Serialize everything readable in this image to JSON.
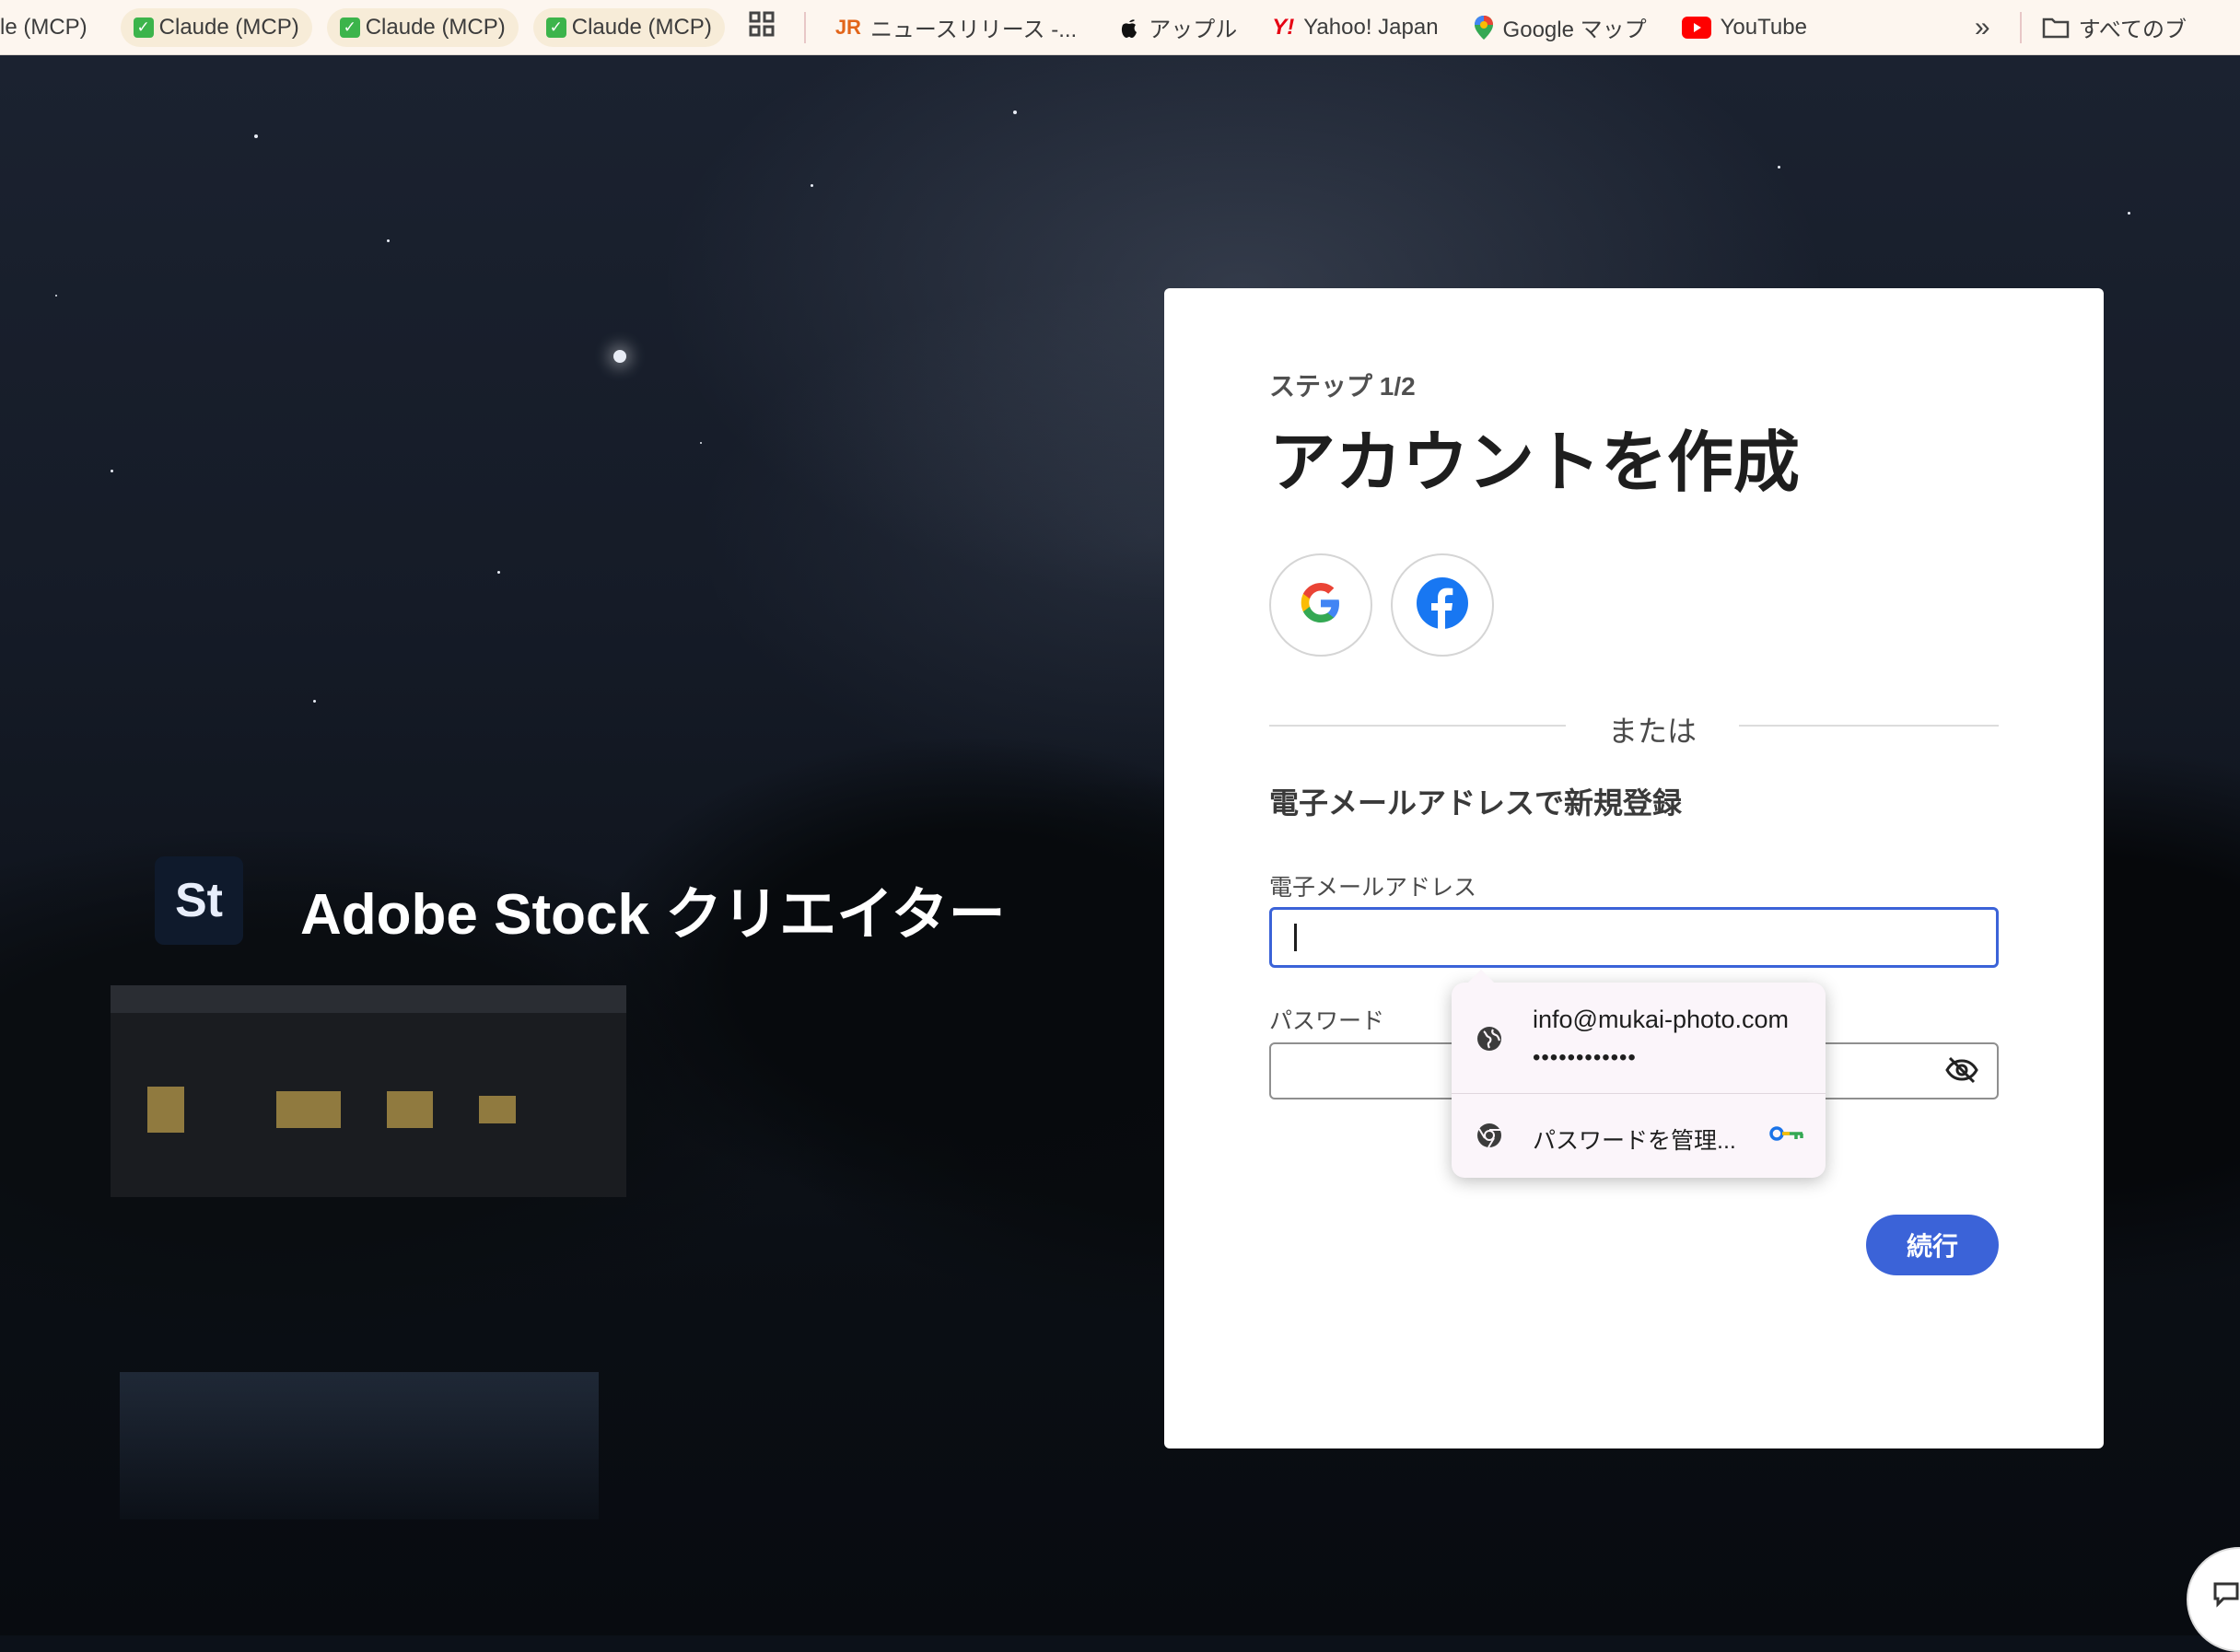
{
  "bookmarks": {
    "items": [
      {
        "label": "le (MCP)",
        "icon": "check-icon"
      },
      {
        "label": "Claude (MCP)",
        "icon": "check-icon"
      },
      {
        "label": "Claude (MCP)",
        "icon": "check-icon"
      },
      {
        "label": "Claude (MCP)",
        "icon": "check-icon"
      }
    ],
    "links": [
      {
        "label": "ニュースリリース -...",
        "icon": "jr-icon"
      },
      {
        "label": "アップル",
        "icon": "apple-icon"
      },
      {
        "label": "Yahoo! Japan",
        "icon": "yahoo-icon"
      },
      {
        "label": "Google マップ",
        "icon": "google-maps-icon"
      },
      {
        "label": "YouTube",
        "icon": "youtube-icon"
      }
    ],
    "all_bookmarks_label": "すべてのブ"
  },
  "brand": {
    "logo_text": "St",
    "title": "Adobe Stock クリエイター"
  },
  "signup": {
    "step": "ステップ 1/2",
    "heading": "アカウントを作成",
    "divider_text": "または",
    "subheading": "電子メールアドレスで新規登録",
    "email_label": "電子メールアドレス",
    "email_value": "",
    "password_label": "パスワード",
    "continue_label": "続行"
  },
  "autofill": {
    "email": "info@mukai-photo.com",
    "masked_password": "••••••••••••",
    "manage_label": "パスワードを管理..."
  },
  "colors": {
    "accent": "#3b63d8",
    "card_bg": "#ffffff",
    "autofill_bg": "#fbf5fa",
    "facebook": "#1877f2"
  }
}
